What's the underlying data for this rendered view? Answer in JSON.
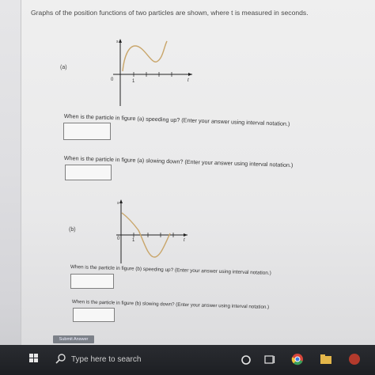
{
  "header": {
    "prompt": "Graphs of the position functions of two particles are shown, where t is measured in seconds."
  },
  "graph_a": {
    "label": "(a)",
    "y_axis": "s",
    "x_axis": "t",
    "zero_tick": "0",
    "one_tick": "1"
  },
  "graph_b": {
    "label": "(b)",
    "y_axis": "s",
    "x_axis": "t",
    "zero_tick": "0",
    "one_tick": "1"
  },
  "questions": {
    "a_speeding": "When is the particle in figure (a) speeding up? (Enter your answer using interval notation.)",
    "a_slowing": "When is the particle in figure (a) slowing down? (Enter your answer using interval notation.)",
    "b_speeding": "When is the particle in figure (b) speeding up? (Enter your answer using interval notation.)",
    "b_slowing": "When is the particle in figure (b) slowing down? (Enter your answer using interval notation.)"
  },
  "answers": {
    "a_speeding": "",
    "a_slowing": "",
    "b_speeding": "",
    "b_slowing": ""
  },
  "submit_label": "Submit Answer",
  "taskbar": {
    "search_placeholder": "Type here to search",
    "icons": [
      "windows-icon",
      "search-icon",
      "cortana-icon",
      "task-view-icon",
      "chrome-icon"
    ]
  }
}
